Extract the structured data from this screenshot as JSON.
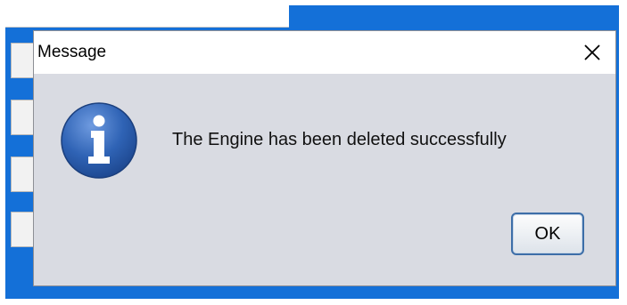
{
  "dialog": {
    "title": "Message",
    "message": "The Engine has been deleted successfully",
    "ok_label": "OK",
    "icon": "info-icon",
    "close_icon": "close-icon"
  },
  "colors": {
    "background_window": "#1470d8",
    "dialog_body": "#d9dbe2",
    "titlebar": "#ffffff",
    "ok_border": "#3d6ea8",
    "icon_blue": "#2f63b5"
  }
}
